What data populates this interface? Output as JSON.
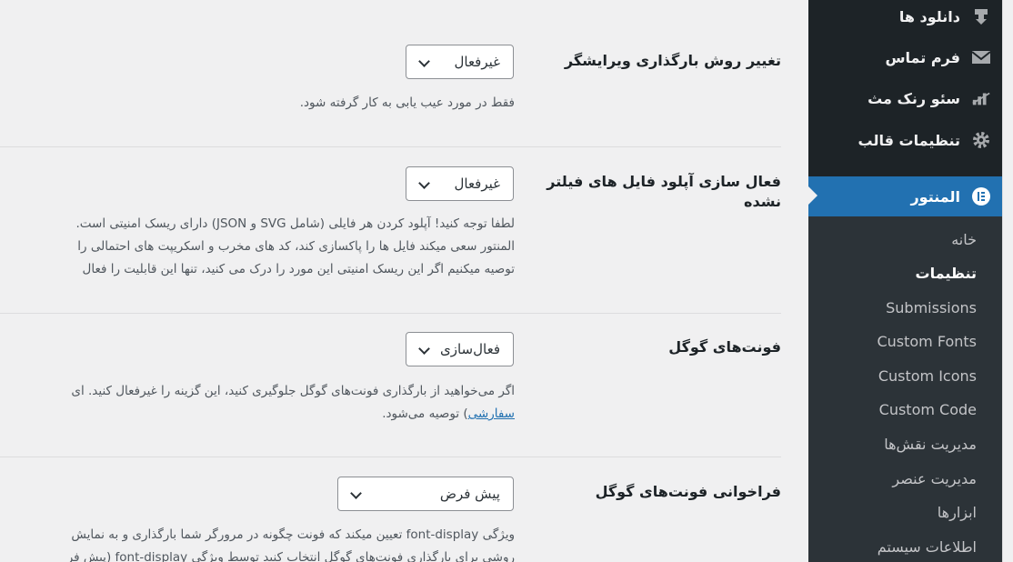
{
  "settings": [
    {
      "title": "تغییر روش بارگذاری ویرایشگر",
      "select_value": "غیرفعال",
      "desc_lines": [
        "فقط در مورد عیب یابی به کار گرفته شود."
      ]
    },
    {
      "title_line1": "فعال سازی آپلود فایل های فیلتر",
      "title_line2": "نشده",
      "select_value": "غیرفعال",
      "desc_lines": [
        "لطفا توجه کنید! آپلود کردن هر فایلی (شامل SVG و JSON) دارای ریسک امنیتی است.",
        "المنتور سعی میکند فایل ها را پاکسازی کند، کد های مخرب و اسکریپت های احتمالی را",
        "توصیه میکنیم اگر این ریسک امنیتی این مورد را درک می کنید، تنها این قابلیت را فعال"
      ]
    },
    {
      "title": "فونت‌های گوگل",
      "select_value": "فعال‌سازی",
      "desc_line1": "اگر می‌خواهید از بارگذاری فونت‌های گوگل جلوگیری کنید، این گزینه را غیرفعال کنید. ای",
      "desc_link": "سفارشی",
      "desc_line2_rest": ") توصیه می‌شود."
    },
    {
      "title": "فراخوانی فونت‌های گوگل",
      "select_value": "پیش فرض",
      "desc_lines": [
        "ویژگی font-display تعیین میکند که فونت چگونه در مرورگر شما بارگذاری و به نمایش",
        "روشی برای بارگذاری فونت‌های گوگل انتخاب کنید توسط ویژگی font-display (پیش فر"
      ]
    }
  ],
  "sidebar": {
    "menu": [
      {
        "label": "دانلود ها",
        "icon": "download-icon"
      },
      {
        "label": "فرم تماس",
        "icon": "mail-icon"
      },
      {
        "label": "سئو رنک مث",
        "icon": "chart-icon"
      },
      {
        "label": "تنظیمات قالب",
        "icon": "gear-icon"
      },
      {
        "label": "المنتور",
        "icon": "elementor-icon"
      }
    ],
    "submenu": [
      "خانه",
      "تنظیمات",
      "Submissions",
      "Custom Fonts",
      "Custom Icons",
      "Custom Code",
      "مدیریت نقش‌ها",
      "مدیریت عنصر",
      "ابزارها",
      "اطلاعات سیستم"
    ]
  },
  "colors": {
    "sidebar_bg": "#1d2327",
    "active": "#2271b1",
    "page_bg": "#f0f0f1"
  }
}
